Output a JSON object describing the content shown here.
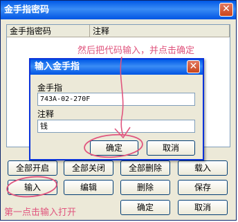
{
  "window": {
    "title": "金手指密码",
    "close_glyph": "✕"
  },
  "list": {
    "columns": [
      "金手指密码",
      "注释"
    ]
  },
  "dialog": {
    "title": "输入金手指",
    "close_glyph": "✕",
    "code_label": "金手指",
    "code_value": "743A-02-270F",
    "note_label": "注释",
    "note_value": "钱",
    "ok_label": "确定",
    "cancel_label": "取消"
  },
  "buttons": {
    "enable_all": "全部开启",
    "disable_all": "全部关闭",
    "delete_all": "全部删除",
    "load": "载入",
    "input": "输入",
    "edit": "编辑",
    "delete": "删除",
    "save": "保存",
    "ok": "确定",
    "cancel": "取消"
  },
  "annotations": {
    "top_note": "然后把代码输入，并点击确定",
    "bottom_note": "第一点击输入打开",
    "color": "#e0557e"
  }
}
